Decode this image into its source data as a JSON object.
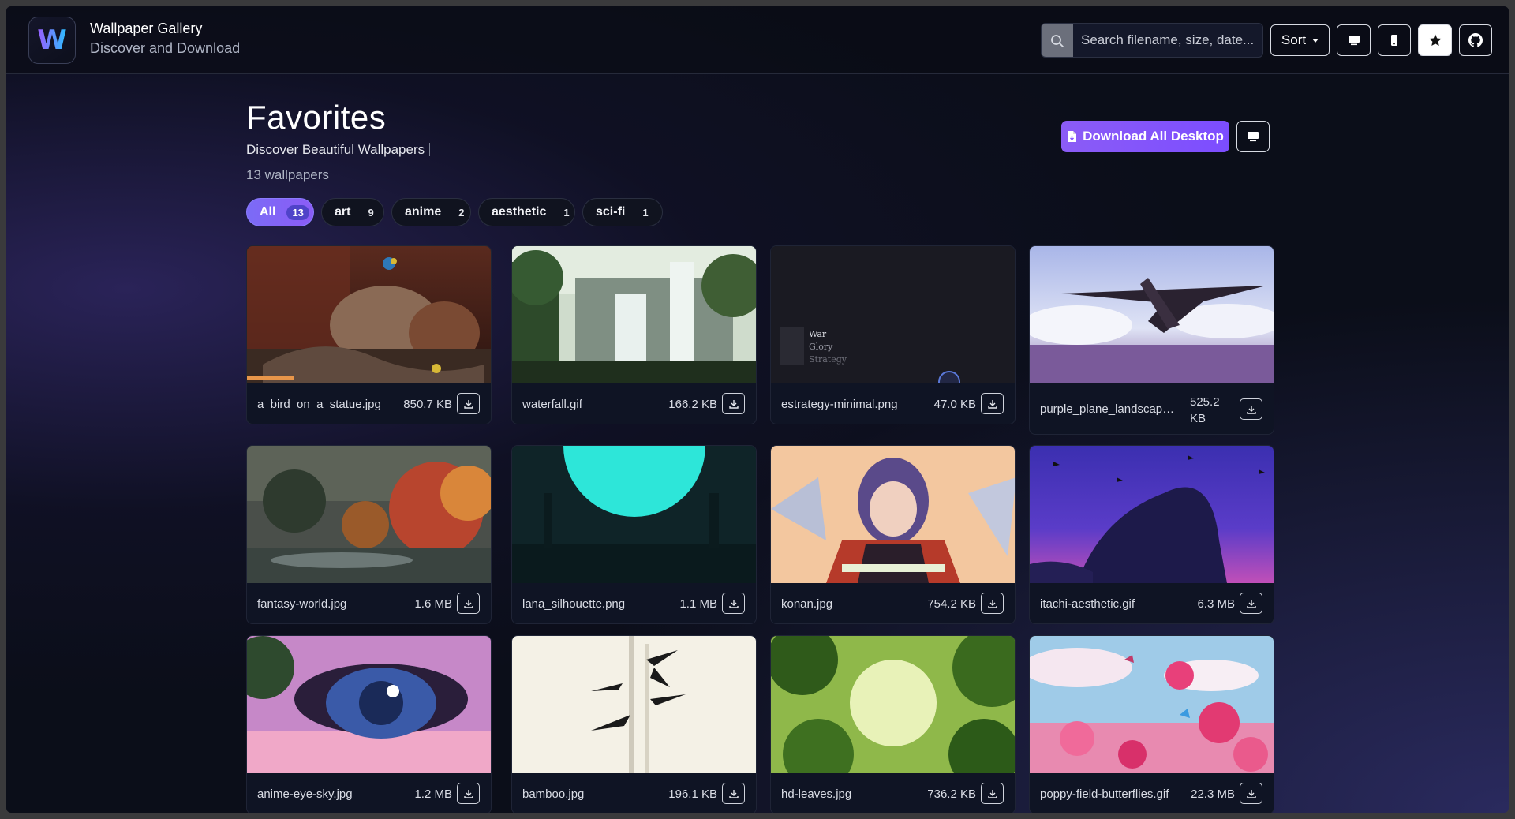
{
  "header": {
    "logo_letter": "W",
    "title": "Wallpaper Gallery",
    "subtitle": "Discover and Download",
    "search_placeholder": "Search filename, size, date...",
    "sort_label": "Sort"
  },
  "page": {
    "title": "Favorites",
    "subtitle": "Discover Beautiful Wallpapers",
    "count": "13 wallpapers",
    "download_all_label": "Download All Desktop"
  },
  "filters": [
    {
      "label": "All",
      "count": "13",
      "active": true
    },
    {
      "label": "art",
      "count": "9",
      "active": false
    },
    {
      "label": "anime",
      "count": "2",
      "active": false
    },
    {
      "label": "aesthetic",
      "count": "1",
      "active": false
    },
    {
      "label": "sci-fi",
      "count": "1",
      "active": false
    }
  ],
  "wallpapers": [
    {
      "name": "a_bird_on_a_statue.jpg",
      "size": "850.7 KB"
    },
    {
      "name": "waterfall.gif",
      "size": "166.2 KB"
    },
    {
      "name": "estrategy-minimal.png",
      "size": "47.0 KB",
      "overlay_lines": [
        "War",
        "Glory",
        "Strategy"
      ]
    },
    {
      "name": "purple_plane_landscape....",
      "size": "525.2 KB"
    },
    {
      "name": "fantasy-world.jpg",
      "size": "1.6 MB"
    },
    {
      "name": "lana_silhouette.png",
      "size": "1.1 MB"
    },
    {
      "name": "konan.jpg",
      "size": "754.2 KB"
    },
    {
      "name": "itachi-aesthetic.gif",
      "size": "6.3 MB"
    },
    {
      "name": "anime-eye-sky.jpg",
      "size": "1.2 MB"
    },
    {
      "name": "bamboo.jpg",
      "size": "196.1 KB"
    },
    {
      "name": "hd-leaves.jpg",
      "size": "736.2 KB"
    },
    {
      "name": "poppy-field-butterflies.gif",
      "size": "22.3 MB"
    }
  ],
  "icons": {
    "search": "search-icon",
    "desktop": "monitor-icon",
    "mobile": "phone-icon",
    "favorites": "star-icon",
    "github": "github-icon",
    "download": "download-icon",
    "file": "file-icon"
  },
  "colors": {
    "accent": "#8b5cf6",
    "background": "#0b0e19"
  }
}
